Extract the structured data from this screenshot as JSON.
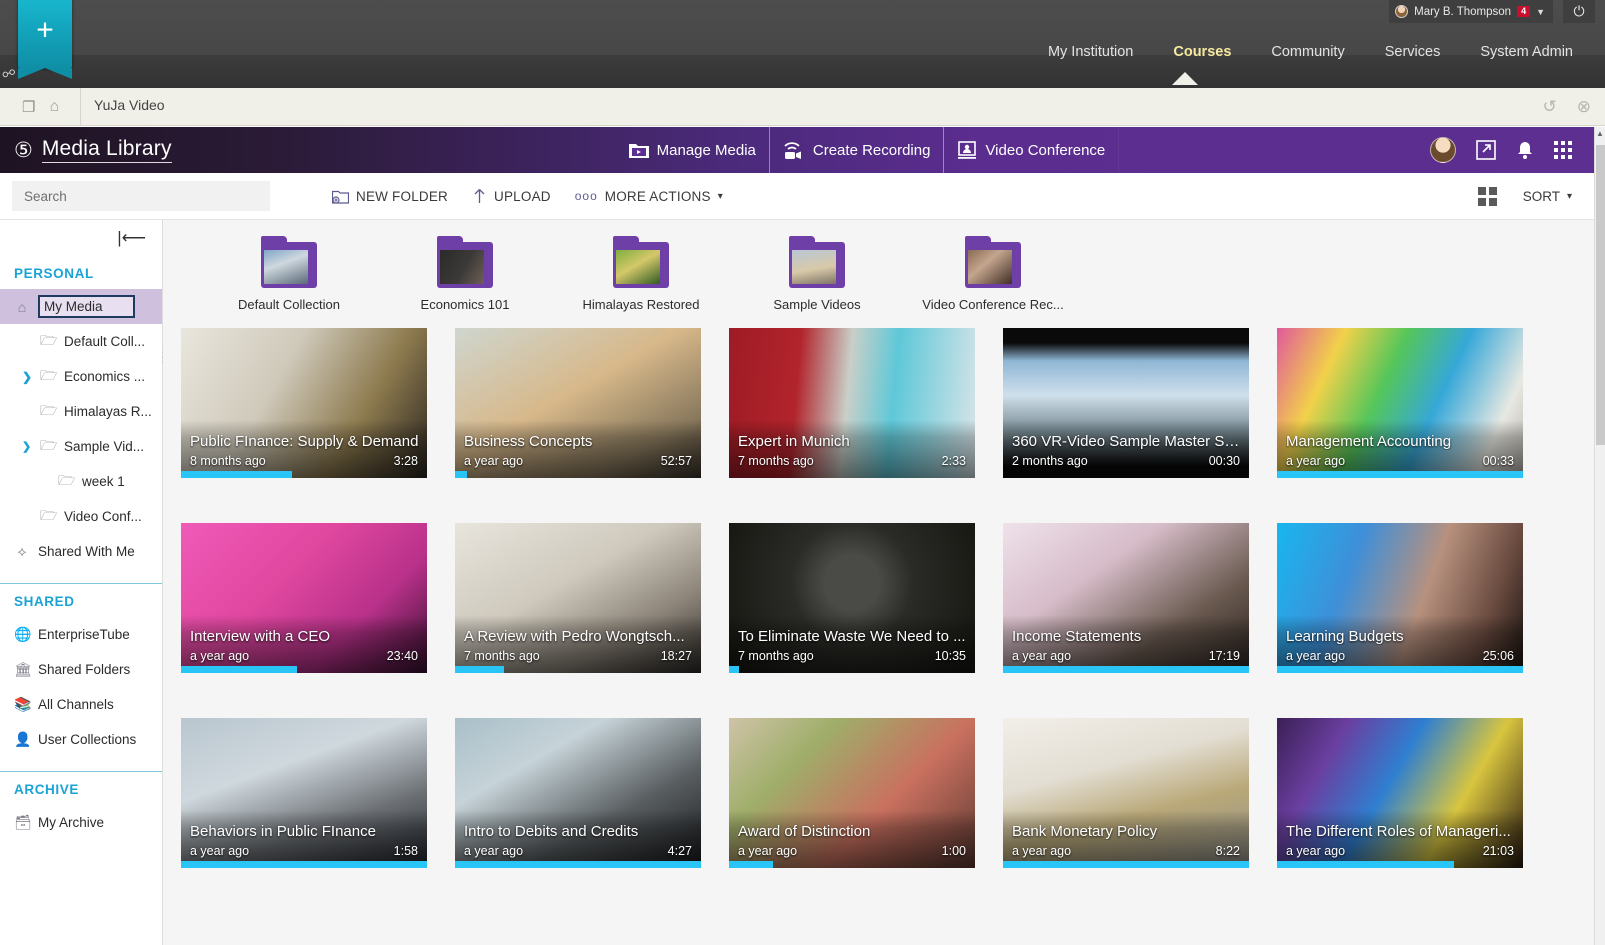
{
  "lms": {
    "user_name": "Mary B. Thompson",
    "notification_count": "4",
    "caret": "▼",
    "power_icon": "⏻",
    "nav": [
      {
        "label": "My Institution",
        "active": false
      },
      {
        "label": "Courses",
        "active": true
      },
      {
        "label": "Community",
        "active": false
      },
      {
        "label": "Services",
        "active": false
      },
      {
        "label": "System Admin",
        "active": false
      }
    ]
  },
  "frame": {
    "title": "YuJa Video",
    "window_icon": "❐",
    "home_icon": "⌂",
    "refresh_icon": "↺",
    "close_icon": "⊗"
  },
  "app_header": {
    "logo_mark": "⑤",
    "logo_text": "Media Library",
    "actions": [
      {
        "label": "Manage Media",
        "icon": "manage-media-icon"
      },
      {
        "label": "Create Recording",
        "icon": "create-recording-icon"
      },
      {
        "label": "Video Conference",
        "icon": "video-conference-icon"
      }
    ],
    "share_icon": "↗",
    "bell_icon": "🔔"
  },
  "toolbar": {
    "search_placeholder": "Search",
    "search_value": "",
    "new_folder_label": "NEW FOLDER",
    "upload_label": "UPLOAD",
    "more_actions_label": "MORE ACTIONS",
    "more_actions_dots": "ooo",
    "caret": "▾",
    "sort_label": "SORT",
    "sort_caret": "▾"
  },
  "sidebar": {
    "collapse_icon": "|⟵",
    "sections": [
      {
        "title": "PERSONAL",
        "items": [
          {
            "label": "My Media",
            "icon": "home-icon",
            "level": 0,
            "selected": true,
            "chevron": ""
          },
          {
            "label": "Default Coll...",
            "icon": "folder-icon",
            "level": 1,
            "selected": false,
            "chevron": ""
          },
          {
            "label": "Economics ...",
            "icon": "folder-icon",
            "level": 1,
            "selected": false,
            "chevron": "❯"
          },
          {
            "label": "Himalayas R...",
            "icon": "folder-icon",
            "level": 1,
            "selected": false,
            "chevron": ""
          },
          {
            "label": "Sample Vid...",
            "icon": "folder-icon",
            "level": 1,
            "selected": false,
            "chevron": "❯"
          },
          {
            "label": "week 1",
            "icon": "folder-icon",
            "level": 2,
            "selected": false,
            "chevron": ""
          },
          {
            "label": "Video Conf...",
            "icon": "folder-icon",
            "level": 1,
            "selected": false,
            "chevron": ""
          },
          {
            "label": "Shared With Me",
            "icon": "share-nodes-icon",
            "level": 0,
            "selected": false,
            "chevron": ""
          }
        ]
      },
      {
        "title": "SHARED",
        "items": [
          {
            "label": "EnterpriseTube",
            "icon": "globe-icon",
            "level": 0,
            "selected": false,
            "chevron": ""
          },
          {
            "label": "Shared Folders",
            "icon": "bank-icon",
            "level": 0,
            "selected": false,
            "chevron": ""
          },
          {
            "label": "All Channels",
            "icon": "books-icon",
            "level": 0,
            "selected": false,
            "chevron": ""
          },
          {
            "label": "User Collections",
            "icon": "user-icon",
            "level": 0,
            "selected": false,
            "chevron": ""
          }
        ]
      },
      {
        "title": "ARCHIVE",
        "items": [
          {
            "label": "My Archive",
            "icon": "archive-box-icon",
            "level": 0,
            "selected": false,
            "chevron": ""
          }
        ]
      }
    ]
  },
  "folders": [
    {
      "label": "Default Collection"
    },
    {
      "label": "Economics 101"
    },
    {
      "label": "Himalayas Restored"
    },
    {
      "label": "Sample Videos"
    },
    {
      "label": "Video Conference Rec..."
    }
  ],
  "videos": [
    {
      "title": "Public FInance: Supply & Demand",
      "date": "8 months ago",
      "duration": "3:28",
      "progress": 45
    },
    {
      "title": "Business Concepts",
      "date": "a year ago",
      "duration": "52:57",
      "progress": 5
    },
    {
      "title": "Expert in Munich",
      "date": "7 months ago",
      "duration": "2:33",
      "progress": 0
    },
    {
      "title": "360 VR-Video Sample Master Se...",
      "date": "2 months ago",
      "duration": "00:30",
      "progress": 0
    },
    {
      "title": "Management Accounting",
      "date": "a year ago",
      "duration": "00:33",
      "progress": 100
    },
    {
      "title": "Interview with a CEO",
      "date": "a year ago",
      "duration": "23:40",
      "progress": 47
    },
    {
      "title": "A Review with Pedro Wongtsch...",
      "date": "7 months ago",
      "duration": "18:27",
      "progress": 20
    },
    {
      "title": "To Eliminate Waste We Need to ...",
      "date": "7 months ago",
      "duration": "10:35",
      "progress": 4
    },
    {
      "title": "Income Statements",
      "date": "a year ago",
      "duration": "17:19",
      "progress": 100
    },
    {
      "title": "Learning Budgets",
      "date": "a year ago",
      "duration": "25:06",
      "progress": 100
    },
    {
      "title": "Behaviors in Public FInance",
      "date": "a year ago",
      "duration": "1:58",
      "progress": 100
    },
    {
      "title": "Intro to Debits and Credits",
      "date": "a year ago",
      "duration": "4:27",
      "progress": 100
    },
    {
      "title": "Award of Distinction",
      "date": "a year ago",
      "duration": "1:00",
      "progress": 18
    },
    {
      "title": "Bank Monetary Policy",
      "date": "a year ago",
      "duration": "8:22",
      "progress": 100
    },
    {
      "title": "The Different Roles of Manageri...",
      "date": "a year ago",
      "duration": "21:03",
      "progress": 72
    }
  ],
  "colors": {
    "brand_purple": "#5c2f91",
    "accent_cyan": "#29c5f6",
    "sidebar_heading": "#1aa3d4",
    "selection": "#cfc0de"
  }
}
